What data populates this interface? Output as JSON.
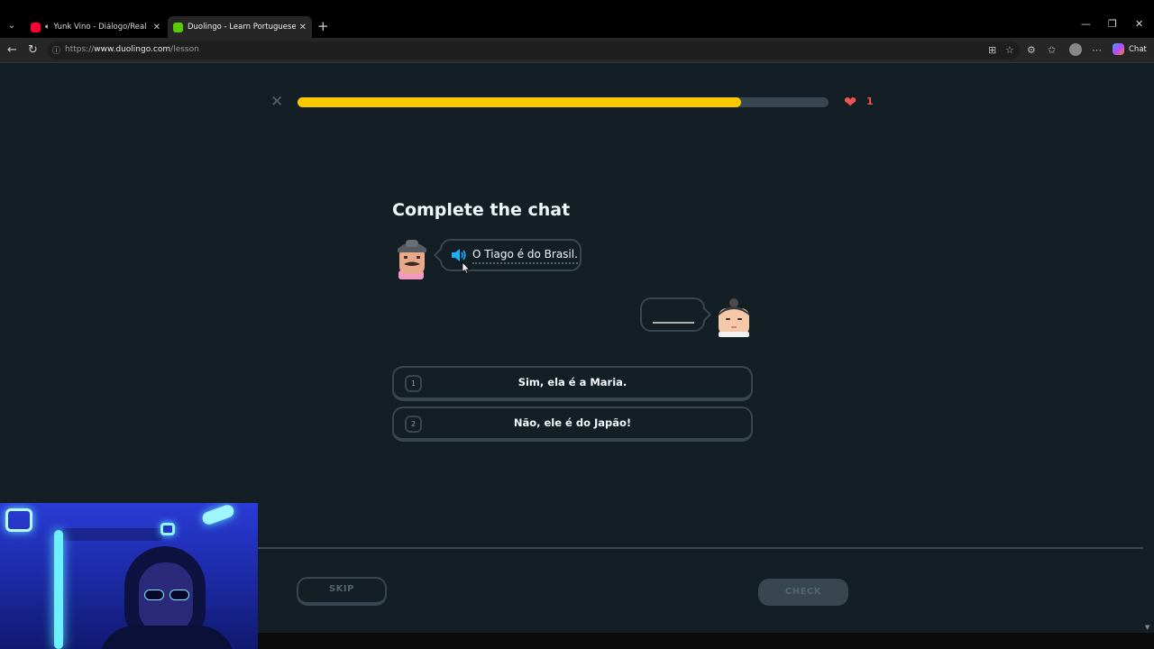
{
  "browser": {
    "tabs": [
      {
        "title": "Yunk Vino - Diálogo/Real (Clip",
        "icon": "youtube-icon",
        "audio": true,
        "active": false
      },
      {
        "title": "Duolingo - Learn Portuguese with",
        "icon": "duolingo-icon",
        "audio": false,
        "active": true
      }
    ],
    "url_prefix": "https://",
    "url_domain": "www.duolingo.com",
    "url_path": "/lesson",
    "chat_label": "Chat"
  },
  "lesson": {
    "progress": 0.835,
    "hearts": "1",
    "title": "Complete the chat",
    "prompt_text": "O Tiago é do Brasil.",
    "choices": [
      {
        "number": "1",
        "text": "Sim, ela é a Maria."
      },
      {
        "number": "2",
        "text": "Não, ele é do Japão!"
      }
    ],
    "skip_label": "SKIP",
    "check_label": "CHECK"
  },
  "colors": {
    "background": "#131f24",
    "progress_fill": "#fac900",
    "border": "#37464f",
    "heart": "#ee5555"
  }
}
